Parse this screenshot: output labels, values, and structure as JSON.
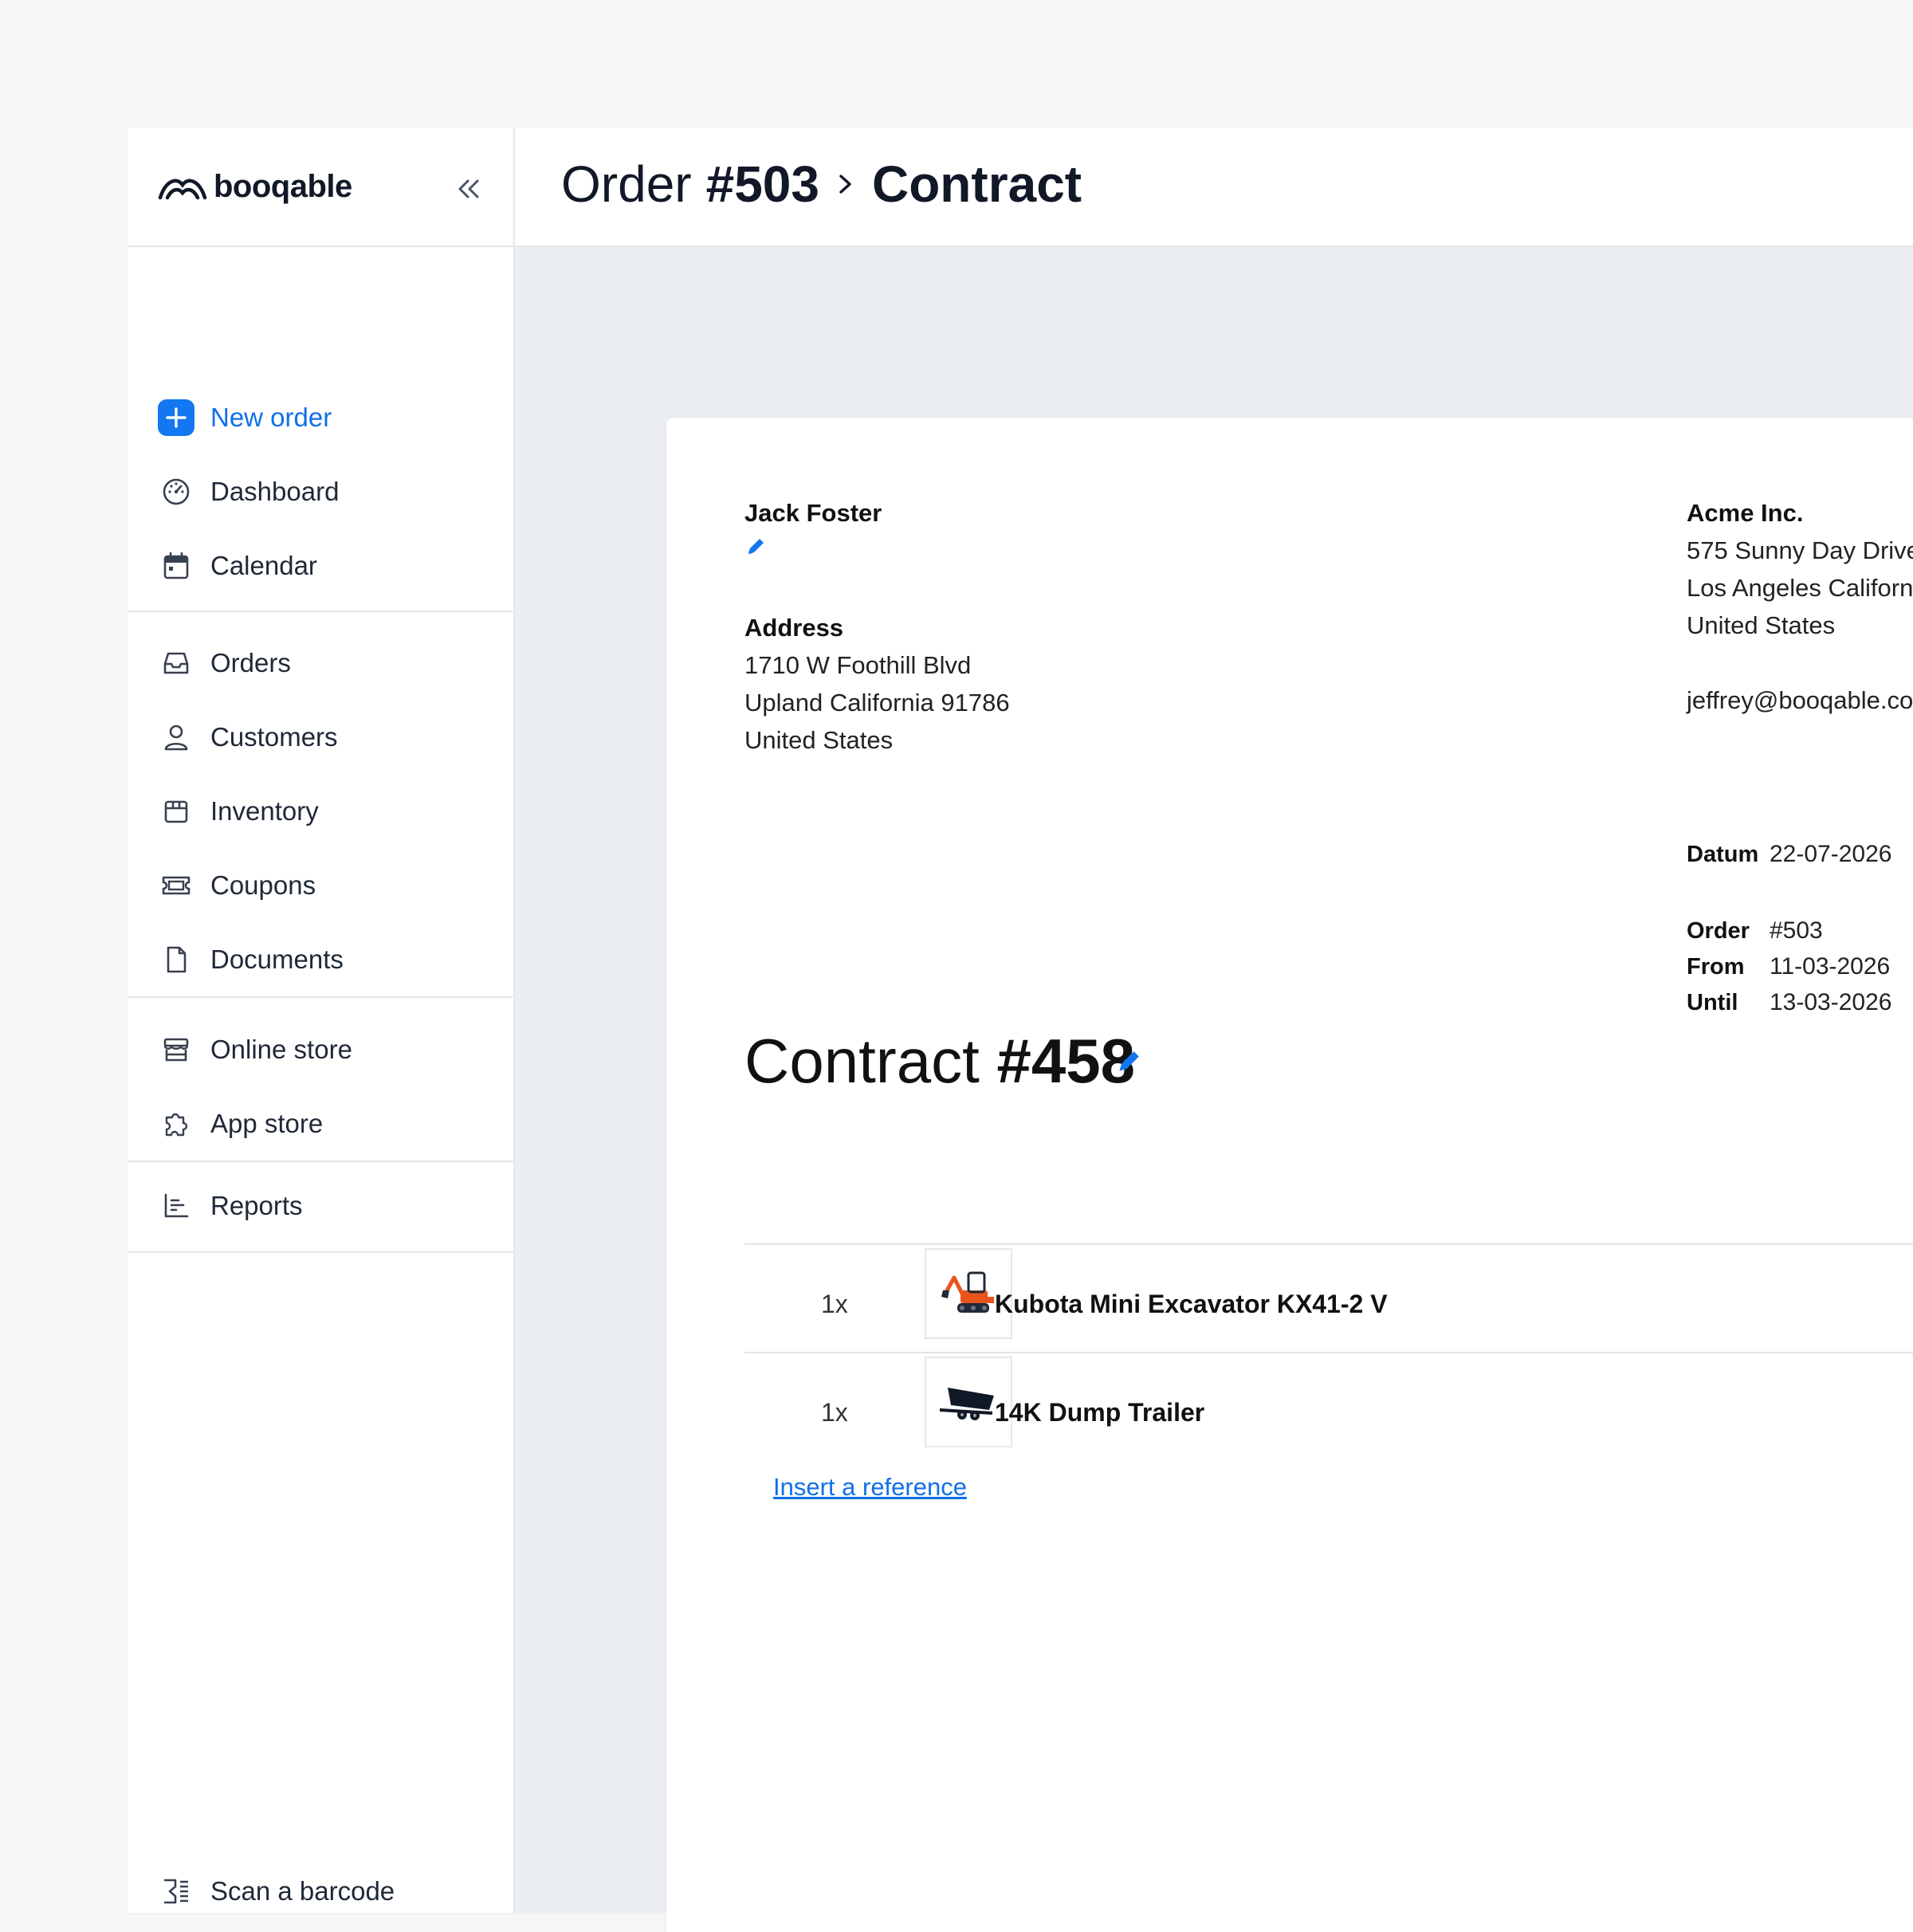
{
  "brand": {
    "name": "booqable"
  },
  "sidebar": {
    "new_order": "New order",
    "items": [
      {
        "label": "Dashboard"
      },
      {
        "label": "Calendar"
      },
      {
        "label": "Orders"
      },
      {
        "label": "Customers"
      },
      {
        "label": "Inventory"
      },
      {
        "label": "Coupons"
      },
      {
        "label": "Documents"
      },
      {
        "label": "Online store"
      },
      {
        "label": "App store"
      },
      {
        "label": "Reports"
      }
    ],
    "scan_barcode": "Scan a barcode"
  },
  "header": {
    "order_word": "Order",
    "order_number": "#503",
    "current": "Contract"
  },
  "document": {
    "customer_name": "Jack Foster",
    "address_label": "Address",
    "address_lines": [
      "1710 W Foothill Blvd",
      "Upland California 91786",
      "United States"
    ],
    "company_name": "Acme Inc.",
    "company_lines": [
      "575 Sunny Day Drive",
      "Los Angeles Californ",
      "United States"
    ],
    "company_email": "jeffrey@booqable.co",
    "datum_label": "Datum",
    "datum_value": "22-07-2026",
    "order_label": "Order",
    "order_value": "#503",
    "from_label": "From",
    "from_value": "11-03-2026",
    "until_label": "Until",
    "until_value": "13-03-2026",
    "contract_word": "Contract",
    "contract_number": "#458",
    "lines": [
      {
        "qty": "1x",
        "name": "Kubota Mini Excavator KX41-2 V"
      },
      {
        "qty": "1x",
        "name": "14K Dump Trailer"
      }
    ],
    "insert_reference": "Insert a reference"
  },
  "colors": {
    "accent": "#1277f0",
    "canvas": "#eceff2",
    "border": "#e5e7eb"
  }
}
